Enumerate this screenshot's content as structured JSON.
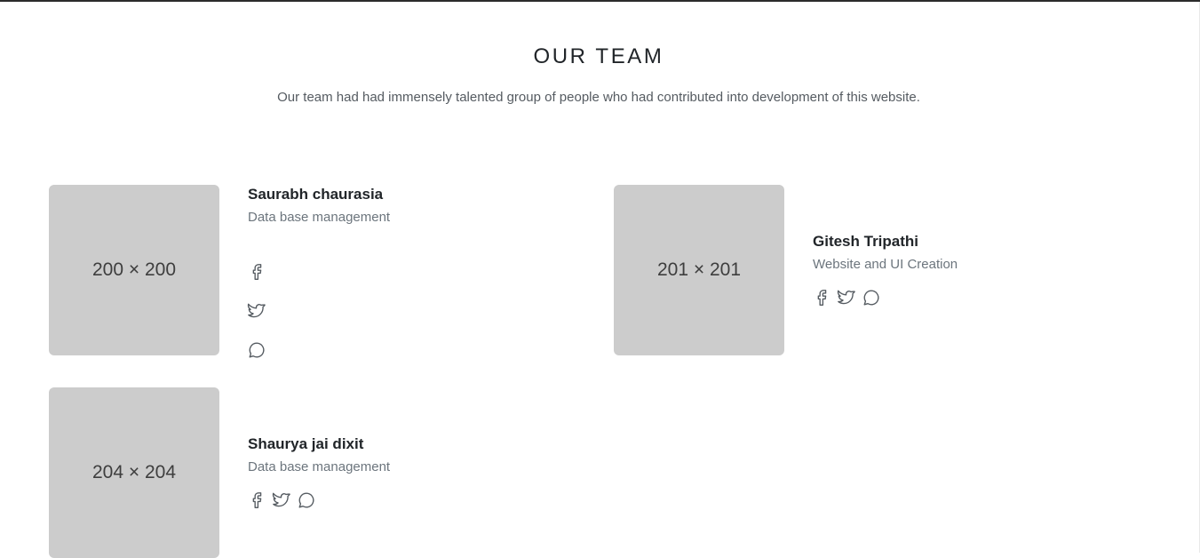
{
  "section": {
    "title": "OUR TEAM",
    "subtitle": "Our team had had immensely talented group of people who had contributed into development of this website."
  },
  "team": [
    {
      "photo_label": "200 × 200",
      "name": "Saurabh chaurasia",
      "role": "Data base management",
      "socials": [
        "facebook-icon",
        "twitter-icon",
        "chat-icon"
      ],
      "social_layout": "vertical"
    },
    {
      "photo_label": "201 × 201",
      "name": "Gitesh Tripathi",
      "role": "Website and UI Creation",
      "socials": [
        "facebook-icon",
        "twitter-icon",
        "chat-icon"
      ],
      "social_layout": "horizontal"
    },
    {
      "photo_label": "204 × 204",
      "name": "Shaurya jai dixit",
      "role": "Data base management",
      "socials": [
        "facebook-icon",
        "twitter-icon",
        "chat-icon"
      ],
      "social_layout": "horizontal"
    }
  ],
  "colors": {
    "photo_placeholder": "#cccccc",
    "icon_stroke": "#555b61",
    "role_text": "#6c757d",
    "heading_text": "#212529"
  }
}
